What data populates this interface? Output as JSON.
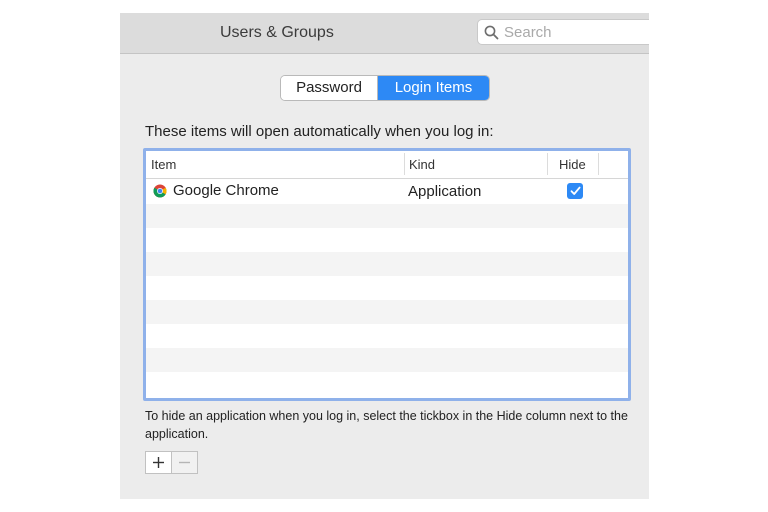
{
  "window": {
    "title": "Users & Groups"
  },
  "search": {
    "placeholder": "Search"
  },
  "tabs": [
    {
      "label": "Password",
      "selected": false
    },
    {
      "label": "Login Items",
      "selected": true
    }
  ],
  "intro_text": "These items will open automatically when you log in:",
  "table": {
    "columns": [
      "Item",
      "Kind",
      "Hide"
    ],
    "rows": [
      {
        "item": "Google Chrome",
        "icon": "chrome-icon",
        "kind": "Application",
        "hide": true
      }
    ]
  },
  "help_text": "To hide an application when you log in, select the tickbox in the Hide column next to the application.",
  "buttons": {
    "add": "+",
    "remove": "−"
  },
  "colors": {
    "accent": "#2d89f5",
    "table_focus": "#8fb1ea"
  }
}
